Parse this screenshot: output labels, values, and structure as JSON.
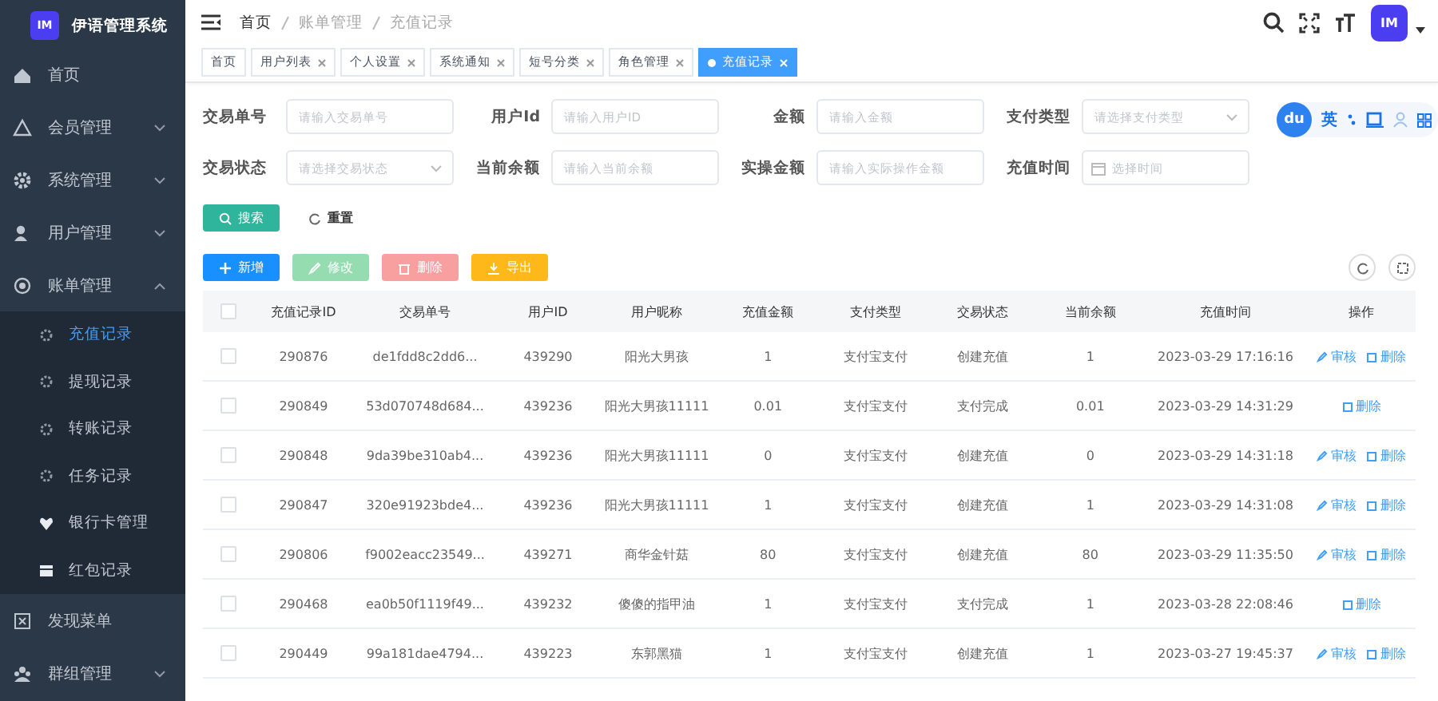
{
  "app": {
    "title": "伊语管理系统",
    "logo": "IM"
  },
  "sidebar": {
    "items": [
      {
        "label": "首页",
        "has_children": false
      },
      {
        "label": "会员管理",
        "has_children": true,
        "expanded": false
      },
      {
        "label": "系统管理",
        "has_children": true,
        "expanded": false
      },
      {
        "label": "用户管理",
        "has_children": true,
        "expanded": false
      },
      {
        "label": "账单管理",
        "has_children": true,
        "expanded": true,
        "children": [
          {
            "label": "充值记录",
            "selected": true
          },
          {
            "label": "提现记录",
            "selected": false
          },
          {
            "label": "转账记录",
            "selected": false
          },
          {
            "label": "任务记录",
            "selected": false
          },
          {
            "label": "银行卡管理",
            "selected": false
          },
          {
            "label": "红包记录",
            "selected": false
          }
        ]
      },
      {
        "label": "发现菜单",
        "has_children": false
      },
      {
        "label": "群组管理",
        "has_children": true,
        "expanded": false
      }
    ]
  },
  "breadcrumb": [
    "首页",
    "账单管理",
    "充值记录"
  ],
  "header": {
    "avatar": "IM"
  },
  "tabs": [
    {
      "label": "首页",
      "closable": false,
      "selected": false
    },
    {
      "label": "用户列表",
      "closable": true,
      "selected": false
    },
    {
      "label": "个人设置",
      "closable": true,
      "selected": false
    },
    {
      "label": "系统通知",
      "closable": true,
      "selected": false
    },
    {
      "label": "短号分类",
      "closable": true,
      "selected": false
    },
    {
      "label": "角色管理",
      "closable": true,
      "selected": false
    },
    {
      "label": "充值记录",
      "closable": true,
      "selected": true
    }
  ],
  "filters": [
    {
      "label": "交易单号",
      "kind": "text",
      "placeholder": "请输入交易单号"
    },
    {
      "label": "用户Id",
      "kind": "text",
      "placeholder": "请输入用户ID"
    },
    {
      "label": "金额",
      "kind": "text",
      "placeholder": "请输入金额"
    },
    {
      "label": "支付类型",
      "kind": "select",
      "placeholder": "请选择支付类型"
    },
    {
      "label": "交易状态",
      "kind": "select",
      "placeholder": "请选择交易状态"
    },
    {
      "label": "当前余额",
      "kind": "text",
      "placeholder": "请输入当前余额"
    },
    {
      "label": "实操金额",
      "kind": "text",
      "placeholder": "请输入实际操作金额"
    },
    {
      "label": "充值时间",
      "kind": "date",
      "placeholder": "选择时间"
    }
  ],
  "ime_toolbar": {
    "logo": "du",
    "mode": "英"
  },
  "search_buttons": [
    {
      "label": "搜索",
      "kind": "primary"
    },
    {
      "label": "重置",
      "kind": "plain"
    }
  ],
  "toolbar_buttons": [
    {
      "label": "新增",
      "kind": "add"
    },
    {
      "label": "修改",
      "kind": "edit"
    },
    {
      "label": "删除",
      "kind": "delete"
    },
    {
      "label": "导出",
      "kind": "export"
    }
  ],
  "table": {
    "header_checked": false,
    "columns": [
      "充值记录ID",
      "交易单号",
      "用户ID",
      "用户昵称",
      "充值金额",
      "支付类型",
      "交易状态",
      "当前余额",
      "充值时间",
      "操作"
    ],
    "rows": [
      {
        "checked": false,
        "cells": [
          "290876",
          "de1fdd8c2dd6...",
          "439290",
          "阳光大男孩",
          "1",
          "支付宝支付",
          "创建充值",
          "1",
          "2023-03-29 17:16:16"
        ],
        "actions": [
          "审核",
          "删除"
        ]
      },
      {
        "checked": false,
        "cells": [
          "290849",
          "53d070748d684...",
          "439236",
          "阳光大男孩11111",
          "0.01",
          "支付宝支付",
          "支付完成",
          "0.01",
          "2023-03-29 14:31:29"
        ],
        "actions": [
          "删除"
        ]
      },
      {
        "checked": false,
        "cells": [
          "290848",
          "9da39be310ab4...",
          "439236",
          "阳光大男孩11111",
          "0",
          "支付宝支付",
          "创建充值",
          "0",
          "2023-03-29 14:31:18"
        ],
        "actions": [
          "审核",
          "删除"
        ]
      },
      {
        "checked": false,
        "cells": [
          "290847",
          "320e91923bde4...",
          "439236",
          "阳光大男孩11111",
          "1",
          "支付宝支付",
          "创建充值",
          "1",
          "2023-03-29 14:31:08"
        ],
        "actions": [
          "审核",
          "删除"
        ]
      },
      {
        "checked": false,
        "cells": [
          "290806",
          "f9002eacc23549...",
          "439271",
          "商华金针菇",
          "80",
          "支付宝支付",
          "创建充值",
          "80",
          "2023-03-29 11:35:50"
        ],
        "actions": [
          "审核",
          "删除"
        ]
      },
      {
        "checked": false,
        "cells": [
          "290468",
          "ea0b50f1119f49...",
          "439232",
          "傻傻的指甲油",
          "1",
          "支付宝支付",
          "支付完成",
          "1",
          "2023-03-28 22:08:46"
        ],
        "actions": [
          "删除"
        ]
      },
      {
        "checked": false,
        "cells": [
          "290449",
          "99a181dae4794...",
          "439223",
          "东郭黑猫",
          "1",
          "支付宝支付",
          "创建充值",
          "1",
          "2023-03-27 19:45:37"
        ],
        "actions": [
          "审核",
          "删除"
        ]
      }
    ]
  }
}
